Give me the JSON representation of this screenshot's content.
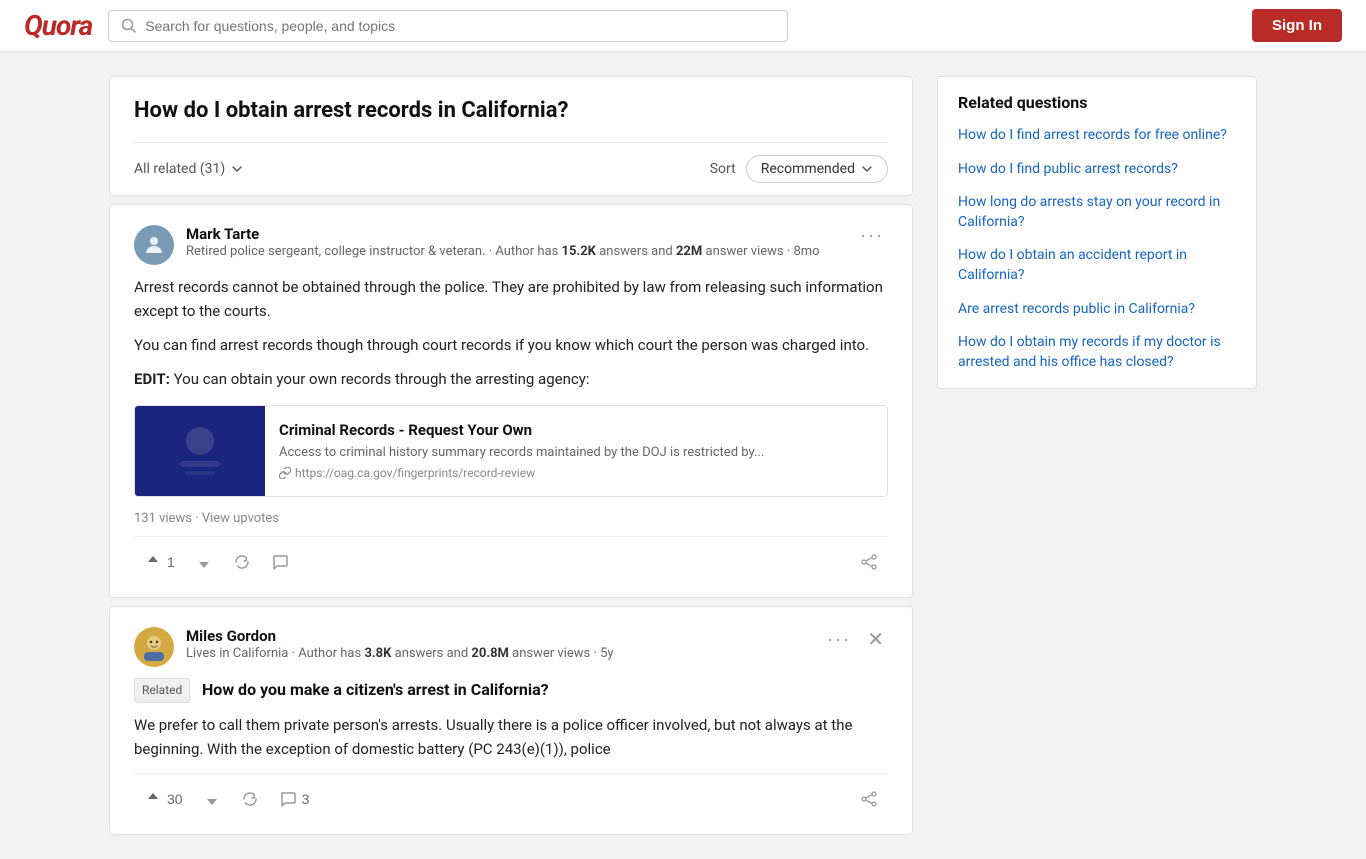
{
  "header": {
    "logo": "Quora",
    "search_placeholder": "Search for questions, people, and topics",
    "sign_in_label": "Sign In"
  },
  "question": {
    "title": "How do I obtain arrest records in California?",
    "filter_label": "All related (31)",
    "sort_label": "Sort",
    "sort_value": "Recommended"
  },
  "answers": [
    {
      "id": "mark-tarte",
      "author_name": "Mark Tarte",
      "author_bio": "Retired police sergeant, college instructor & veteran. · Author has",
      "stat1": "15.2K",
      "stat1_label": "answers and",
      "stat2": "22M",
      "stat2_label": "answer views · 8mo",
      "text1": "Arrest records cannot be obtained through the police. They are prohibited by law from releasing such information except to the courts.",
      "text2": "You can find arrest records though through court records if you know which court the person was charged into.",
      "edit_label": "EDIT:",
      "edit_text": " You can obtain your own records through the arresting agency:",
      "link_card": {
        "title": "Criminal Records - Request Your Own",
        "desc": "Access to criminal history summary records maintained by the DOJ is restricted by...",
        "url": "https://oag.ca.gov/fingerprints/record-review"
      },
      "views": "131 views",
      "view_upvotes_label": "View upvotes",
      "upvote_count": "1",
      "has_close": false
    },
    {
      "id": "miles-gordon",
      "author_name": "Miles Gordon",
      "author_bio": "Lives in California · Author has",
      "stat1": "3.8K",
      "stat1_label": "answers and",
      "stat2": "20.8M",
      "stat2_label": "answer views · 5y",
      "related_tag": "Related",
      "related_question": "How do you make a citizen's arrest in California?",
      "text1": "We prefer to call them private person's arrests. Usually there is a police officer involved, but not always at the beginning. With the exception of domestic battery (PC 243(e)(1)), police",
      "upvote_count": "30",
      "comment_count": "3",
      "has_close": true
    }
  ],
  "related_questions": {
    "title": "Related questions",
    "items": [
      "How do I find arrest records for free online?",
      "How do I find public arrest records?",
      "How long do arrests stay on your record in California?",
      "How do I obtain an accident report in California?",
      "Are arrest records public in California?",
      "How do I obtain my records if my doctor is arrested and his office has closed?"
    ]
  }
}
